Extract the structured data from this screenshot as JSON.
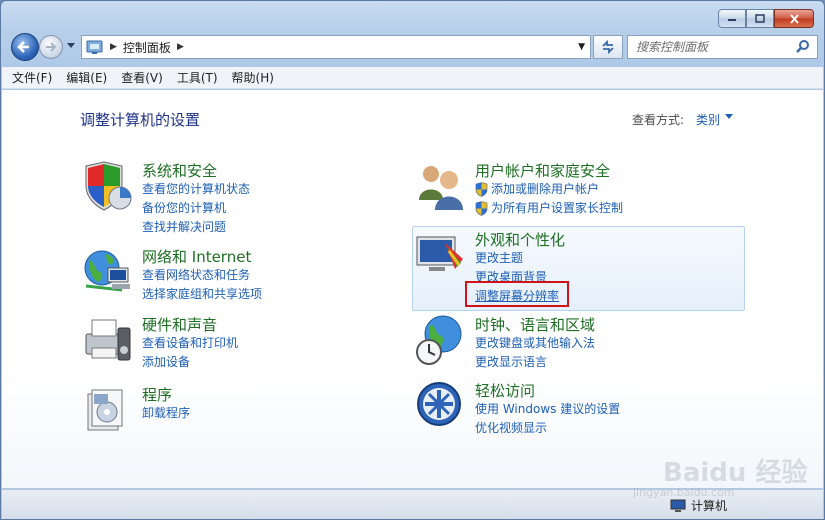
{
  "window": {
    "caption": {
      "minimize": "minimize",
      "maximize": "maximize",
      "close": "close"
    }
  },
  "nav": {
    "breadcrumb": "控制面板",
    "search_placeholder": "搜索控制面板"
  },
  "menu": [
    "文件(F)",
    "编辑(E)",
    "查看(V)",
    "工具(T)",
    "帮助(H)"
  ],
  "page": {
    "title": "调整计算机的设置",
    "view_label": "查看方式:",
    "view_value": "类别"
  },
  "categories": {
    "system": {
      "title": "系统和安全",
      "links": [
        "查看您的计算机状态",
        "备份您的计算机",
        "查找并解决问题"
      ]
    },
    "network": {
      "title": "网络和 Internet",
      "links": [
        "查看网络状态和任务",
        "选择家庭组和共享选项"
      ]
    },
    "hardware": {
      "title": "硬件和声音",
      "links": [
        "查看设备和打印机",
        "添加设备"
      ]
    },
    "programs": {
      "title": "程序",
      "links": [
        "卸载程序"
      ]
    },
    "users": {
      "title": "用户帐户和家庭安全",
      "links": [
        "添加或删除用户帐户",
        "为所有用户设置家长控制"
      ]
    },
    "appearance": {
      "title": "外观和个性化",
      "links": [
        "更改主题",
        "更改桌面背景",
        "调整屏幕分辨率"
      ]
    },
    "clock": {
      "title": "时钟、语言和区域",
      "links": [
        "更改键盘或其他输入法",
        "更改显示语言"
      ]
    },
    "access": {
      "title": "轻松访问",
      "links": [
        "使用 Windows 建议的设置",
        "优化视频显示"
      ]
    }
  },
  "status": {
    "computer": "计算机"
  },
  "watermark": {
    "text": "Baidu 经验",
    "sub": "jingyan.baidu.com"
  },
  "colors": {
    "link": "#1e5fb5",
    "category_title": "#1e6e24",
    "page_title": "#1e3287",
    "highlight": "#d0121a"
  }
}
